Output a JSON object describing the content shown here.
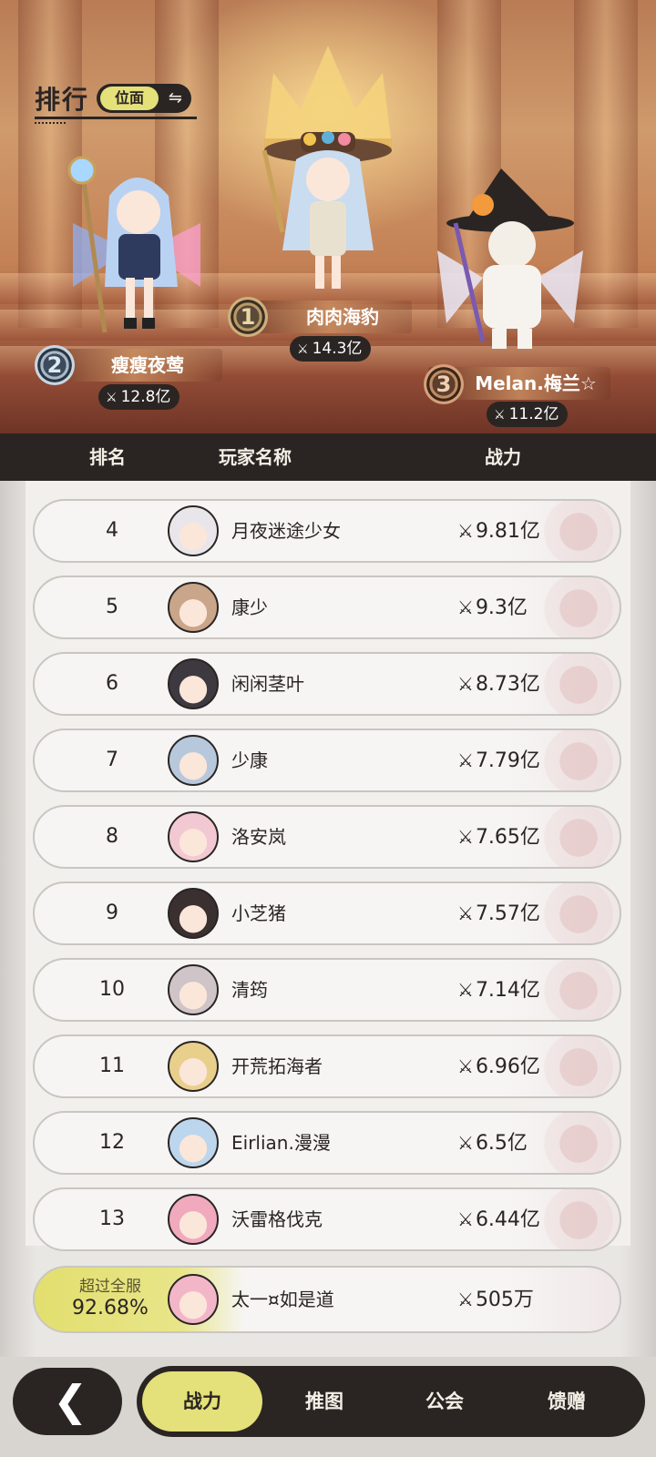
{
  "header": {
    "title": "排行",
    "toggle_label": "位面",
    "toggle_icon": "⇋"
  },
  "top3": [
    {
      "rank": "1",
      "name": "肉肉海豹",
      "power": "14.3亿"
    },
    {
      "rank": "2",
      "name": "瘦瘦夜莺",
      "power": "12.8亿"
    },
    {
      "rank": "3",
      "name": "Melan.梅兰☆",
      "power": "11.2亿"
    }
  ],
  "table_header": {
    "rank": "排名",
    "name": "玩家名称",
    "power": "战力"
  },
  "rows": [
    {
      "rank": "4",
      "name": "月夜迷途少女",
      "power": "9.81亿",
      "avatar_color": "#e8e6ea"
    },
    {
      "rank": "5",
      "name": "康少",
      "power": "9.3亿",
      "avatar_color": "#c9a58a"
    },
    {
      "rank": "6",
      "name": "闲闲茎叶",
      "power": "8.73亿",
      "avatar_color": "#3c3a40"
    },
    {
      "rank": "7",
      "name": "少康",
      "power": "7.79亿",
      "avatar_color": "#b7c8dc"
    },
    {
      "rank": "8",
      "name": "洛安岚",
      "power": "7.65亿",
      "avatar_color": "#f2c9d2"
    },
    {
      "rank": "9",
      "name": "小芝猪",
      "power": "7.57亿",
      "avatar_color": "#3a3030"
    },
    {
      "rank": "10",
      "name": "清筠",
      "power": "7.14亿",
      "avatar_color": "#cfc4c8"
    },
    {
      "rank": "11",
      "name": "开荒拓海者",
      "power": "6.96亿",
      "avatar_color": "#e9cf8c"
    },
    {
      "rank": "12",
      "name": "Eirlian.漫漫",
      "power": "6.5亿",
      "avatar_color": "#bcd6ee"
    },
    {
      "rank": "13",
      "name": "沃雷格伐克",
      "power": "6.44亿",
      "avatar_color": "#f0a9bd"
    }
  ],
  "me": {
    "exceed_label": "超过全服",
    "percent": "92.68%",
    "name": "太一¤如是道",
    "power": "505万",
    "avatar_color": "#f3b6c9"
  },
  "bottom_tabs": [
    "战力",
    "推图",
    "公会",
    "馈赠"
  ],
  "icons": {
    "back": "chevron-left-icon",
    "power": "sword-icon",
    "toggle": "swap-icon"
  },
  "colors": {
    "accent": "#e4e07a",
    "dark": "#2a2523"
  }
}
